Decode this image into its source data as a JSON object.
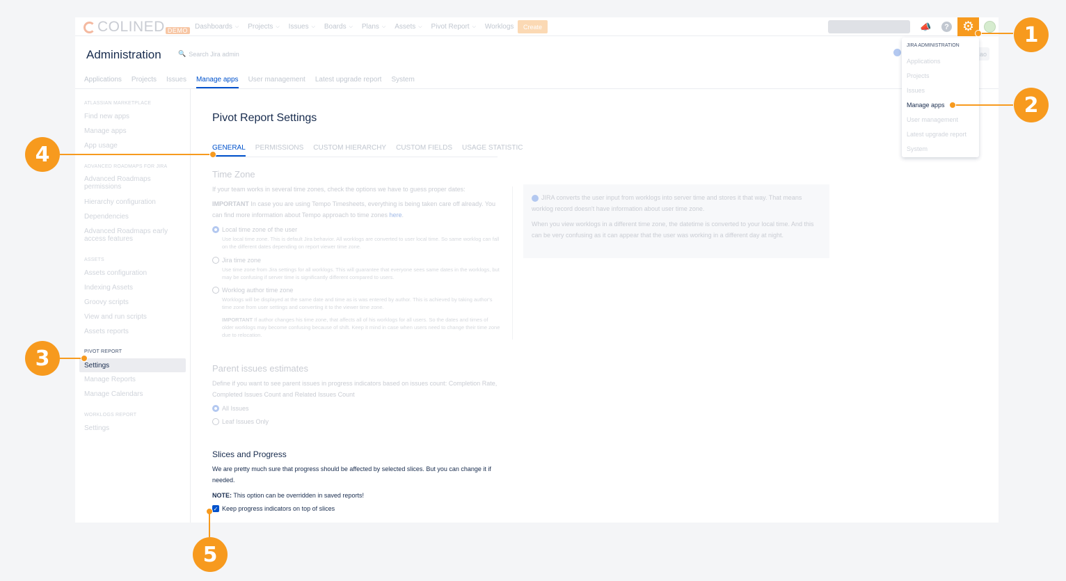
{
  "app": {
    "logo_text": "COLINED",
    "logo_badge": "DEMO",
    "nav": [
      "Dashboards",
      "Projects",
      "Issues",
      "Boards",
      "Plans",
      "Assets",
      "Pivot Report",
      "Worklogs"
    ],
    "create_label": "Create"
  },
  "header": {
    "title": "Administration",
    "search_placeholder": "Search Jira admin",
    "button_label": "ao",
    "tabs": [
      "Applications",
      "Projects",
      "Issues",
      "Manage apps",
      "User management",
      "Latest upgrade report",
      "System"
    ]
  },
  "sidebar": {
    "sections": [
      {
        "title": "ATLASSIAN MARKETPLACE",
        "items": [
          "Find new apps",
          "Manage apps",
          "App usage"
        ]
      },
      {
        "title": "ADVANCED ROADMAPS FOR JIRA",
        "items": [
          "Advanced Roadmaps permissions",
          "Hierarchy configuration",
          "Dependencies",
          "Advanced Roadmaps early access features"
        ]
      },
      {
        "title": "ASSETS",
        "items": [
          "Assets configuration",
          "Indexing Assets",
          "Groovy scripts",
          "View and run scripts",
          "Assets reports"
        ]
      },
      {
        "title": "PIVOT REPORT",
        "items": [
          "Settings",
          "Manage Reports",
          "Manage Calendars"
        ]
      },
      {
        "title": "WORKLOGS REPORT",
        "items": [
          "Settings"
        ]
      }
    ]
  },
  "main": {
    "title": "Pivot Report Settings",
    "tabs": [
      "GENERAL",
      "PERMISSIONS",
      "CUSTOM HIERARCHY",
      "CUSTOM FIELDS",
      "USAGE STATISTIC"
    ],
    "timezone": {
      "title": "Time Zone",
      "intro": "If your team works in several time zones, check the options we have to guess proper dates:",
      "important_label": "IMPORTANT",
      "important_text": " In case you are using Tempo Timesheets, everything is being taken care off already. You can find more information about Tempo approach to time zones ",
      "link": "here",
      "options": [
        {
          "label": "Local time zone of the user",
          "desc": "Use local time zone. This is default Jira behavior. All worklogs are converted to user local time. So same worklog can fall on the different dates depending on report viewer time zone."
        },
        {
          "label": "Jira time zone",
          "desc": "Use time zone from Jira settings for all worklogs. This will guarantee that everyone sees same dates in the worklogs, but may be confusing if server time is significantly different compared to users."
        },
        {
          "label": "Worklog author time zone",
          "desc": "Worklogs will be displayed at the same date and time as is was entered by author. This is achieved by taking author's time zone from user settings and converting it to the viewer time zone."
        }
      ],
      "option3_important": "IMPORTANT",
      "option3_note": " If author changes his time zone, that affects all of his worklogs for all users. So the dates and times of older worklogs may become confusing because of shift. Keep it mind in case when users need to change their time zone due to relocation."
    },
    "info_box": {
      "p1": "JIRA converts the user input from worklogs into server time and stores it that way. That means worklog record doesn't have information about user time zone.",
      "p2": "When you view worklogs in a different time zone, the datetime is converted to your local time. And this can be very confusing as it can appear that the user was working in a different day at night."
    },
    "parent": {
      "title": "Parent issues estimates",
      "desc": "Define if you want to see parent issues in progress indicators based on issues count: Completion Rate, Completed Issues Count and Related Issues Count",
      "options": [
        "All Issues",
        "Leaf Issues Only"
      ]
    },
    "slices": {
      "title": "Slices and Progress",
      "desc": "We are pretty much sure that progress should be affected by selected slices. But you can change it if needed.",
      "note_label": "NOTE:",
      "note_text": " This option can be overridden in saved reports!",
      "checkbox_label": "Keep progress indicators on top of slices",
      "checked": true
    }
  },
  "dropdown": {
    "heading": "JIRA ADMINISTRATION",
    "items": [
      "Applications",
      "Projects",
      "Issues",
      "Manage apps",
      "User management",
      "Latest upgrade report",
      "System"
    ]
  },
  "callouts": [
    "1",
    "2",
    "3",
    "4",
    "5"
  ],
  "colors": {
    "accent": "#f79a1e",
    "link": "#0052cc"
  }
}
